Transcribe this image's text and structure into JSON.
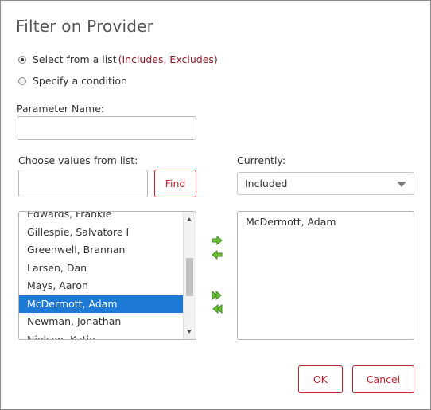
{
  "dialog": {
    "title": "Filter on Provider"
  },
  "mode": {
    "select_list_label": "Select from a list",
    "select_list_hint": "(Includes, Excludes)",
    "specify_condition_label": "Specify a condition",
    "selected": "select_list"
  },
  "parameter": {
    "label": "Parameter Name:",
    "value": "",
    "placeholder": ""
  },
  "values_list": {
    "label": "Choose values from list:",
    "search_value": "",
    "find_label": "Find",
    "items": [
      "Edwards, Frankie",
      "Gillespie, Salvatore I",
      "Greenwell, Brannan",
      "Larsen, Dan",
      "Mays, Aaron",
      "McDermott, Adam",
      "Newman, Jonathan",
      "Nielsen, Katie"
    ],
    "selected_item": "McDermott, Adam",
    "scroll_position": 0.55
  },
  "currently": {
    "label": "Currently:",
    "selected_option": "Included",
    "items": [
      "McDermott, Adam"
    ]
  },
  "transfer_icons": {
    "add": "arrow-right-icon",
    "remove": "arrow-left-icon",
    "add_all": "double-arrow-right-icon",
    "remove_all": "double-arrow-left-icon"
  },
  "footer": {
    "ok_label": "OK",
    "cancel_label": "Cancel"
  },
  "colors": {
    "accent": "#c0242e",
    "hint": "#8b1c2a",
    "selection": "#1e7ad7",
    "arrow_green": "#6cc135"
  }
}
